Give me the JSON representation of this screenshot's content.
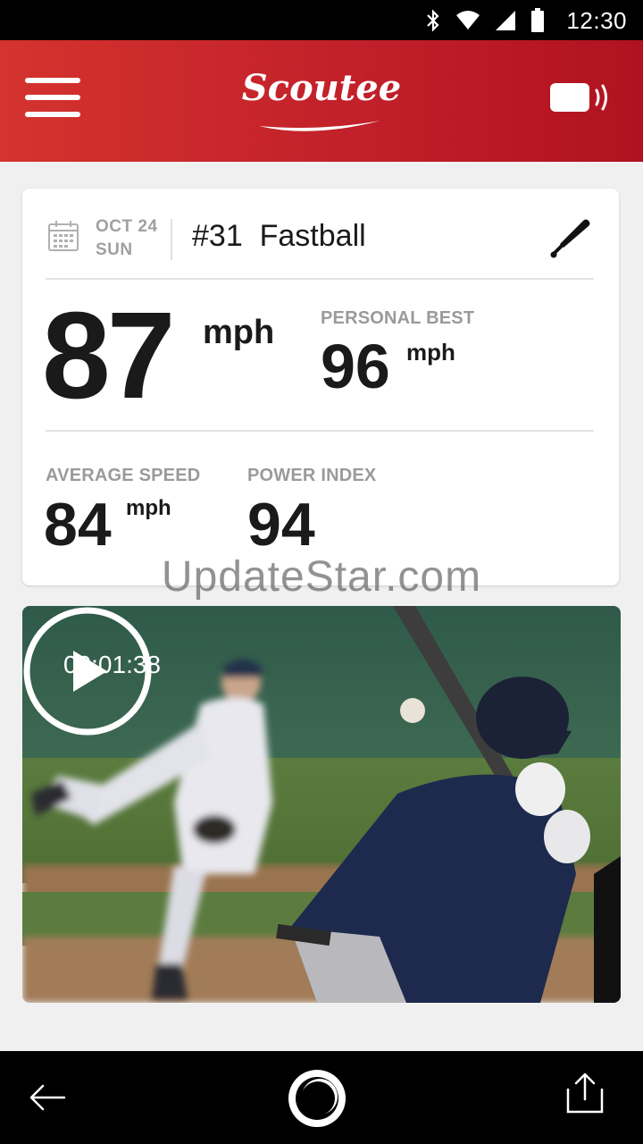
{
  "status_bar": {
    "time": "12:30",
    "icons": [
      "bluetooth-icon",
      "wifi-icon",
      "signal-icon",
      "battery-icon"
    ]
  },
  "app_bar": {
    "logo_text": "Scoutee",
    "menu_icon": "hamburger-menu-icon",
    "device_icon": "sensor-device-icon"
  },
  "pitch": {
    "date_month_day": "OCT 24",
    "date_weekday": "SUN",
    "title": "#31  Fastball",
    "speed": "87",
    "speed_unit": "mph",
    "personal_best_label": "PERSONAL BEST",
    "personal_best_value": "96",
    "personal_best_unit": "mph",
    "average_speed_label": "AVERAGE SPEED",
    "average_speed_value": "84",
    "average_speed_unit": "mph",
    "power_index_label": "POWER INDEX",
    "power_index_value": "94"
  },
  "watermark": "UpdateStar.com",
  "video": {
    "timestamp": "00:01:38"
  },
  "colors": {
    "brand_red": "#c62129",
    "label_gray": "#9a9a9a",
    "text_dark": "#1a1a1a"
  }
}
